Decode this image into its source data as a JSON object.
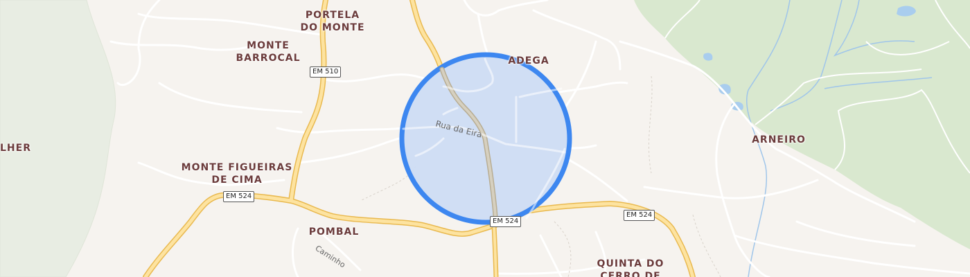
{
  "map": {
    "places": {
      "portela_do_monte": "PORTELA\nDO MONTE",
      "monte_barrocal": "MONTE\nBARROCAL",
      "adega": "ADEGA",
      "lher": "LHER",
      "monte_figueiras_de_cima": "MONTE FIGUEIRAS\nDE CIMA",
      "arneiro": "ARNEIRO",
      "pombal": "POMBAL",
      "quinta_do_cerro_de": "QUINTA DO\nCERRO DE"
    },
    "road_shields": {
      "em510": "EM 510",
      "em524_west": "EM 524",
      "em524_center": "EM 524",
      "em524_east": "EM 524"
    },
    "street_labels": {
      "rua_da_eira": "Rua da Eira",
      "caminho": "Caminho"
    },
    "colors": {
      "background": "#f6f3ef",
      "forest": "#e8ede3",
      "park": "#d9e8cf",
      "major_road_fill": "#fde3a0",
      "major_road_casing": "#e9b94f",
      "minor_road": "#ffffff",
      "water": "#a9cdee",
      "highlight_fill": "#cddcf3",
      "highlight_stroke": "#3d87f0",
      "label": "#6b3b3b"
    }
  }
}
